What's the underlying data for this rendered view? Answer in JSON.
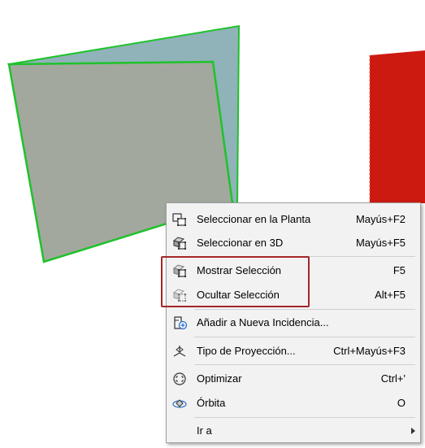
{
  "colors": {
    "back_panel": "#8fb3b8",
    "front_panel": "#a3a89e",
    "selection_outline": "#1fc22a",
    "red_object": "#cc1a10",
    "highlight_box": "#a3262a",
    "menu_bg": "#f2f2f2"
  },
  "menu": {
    "items": [
      {
        "label": "Seleccionar en la Planta",
        "shortcut": "Mayús+F2",
        "icon": "select-in-plan-icon"
      },
      {
        "label": "Seleccionar en 3D",
        "shortcut": "Mayús+F5",
        "icon": "select-in-3d-icon"
      },
      {
        "label": "Mostrar Selección",
        "shortcut": "F5",
        "icon": "show-selection-icon"
      },
      {
        "label": "Ocultar Selección",
        "shortcut": "Alt+F5",
        "icon": "hide-selection-icon"
      },
      {
        "label": "Añadir a Nueva Incidencia...",
        "shortcut": "",
        "icon": "add-issue-icon"
      },
      {
        "label": "Tipo de Proyección...",
        "shortcut": "Ctrl+Mayús+F3",
        "icon": "projection-type-icon"
      },
      {
        "label": "Optimizar",
        "shortcut": "Ctrl+'",
        "icon": "fit-view-icon"
      },
      {
        "label": "Órbita",
        "shortcut": "O",
        "icon": "orbit-icon"
      },
      {
        "label": "Ir a",
        "shortcut": "",
        "icon": "submenu-arrow-icon"
      }
    ]
  }
}
